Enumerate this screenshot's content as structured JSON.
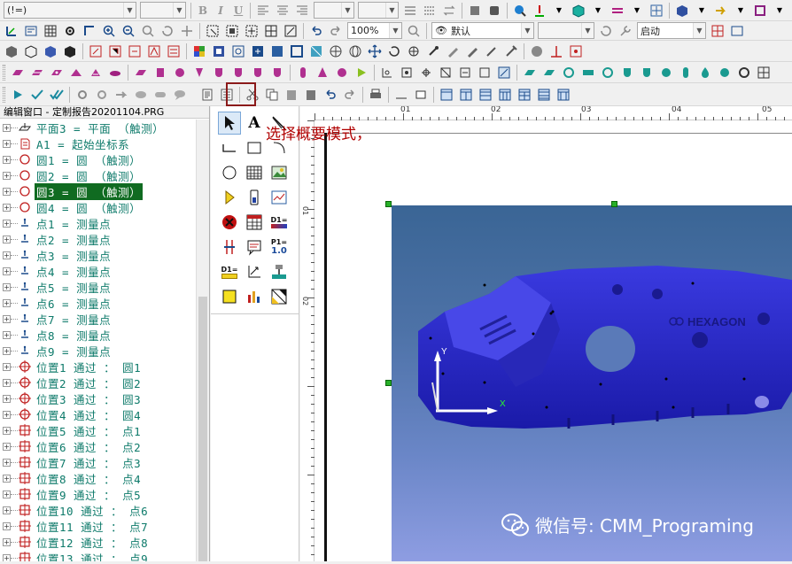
{
  "toolbar1": {
    "font_combo": "(!=)",
    "size_combo": "",
    "bold": "B",
    "italic": "I",
    "underline": "U"
  },
  "toolbar2": {
    "zoom": "100%",
    "view": "默认",
    "mode": "启动"
  },
  "edit_window": {
    "title": "编辑窗口 - 定制报告20201104.PRG",
    "items": [
      {
        "label": "平面3 = 平面 （触测）",
        "icon": "plane-icon",
        "selected": false
      },
      {
        "label": "A1 = 起始坐标系",
        "icon": "alignment-icon",
        "selected": false
      },
      {
        "label": "圆1 = 圆 （触测）",
        "icon": "circle-icon",
        "selected": false
      },
      {
        "label": "圆2 = 圆 （触测）",
        "icon": "circle-icon",
        "selected": false
      },
      {
        "label": "圆3 = 圆 （触测）",
        "icon": "circle-icon",
        "selected": true
      },
      {
        "label": "圆4 = 圆 （触测）",
        "icon": "circle-icon",
        "selected": false
      },
      {
        "label": "点1 = 测量点",
        "icon": "point-icon",
        "selected": false
      },
      {
        "label": "点2 = 测量点",
        "icon": "point-icon",
        "selected": false
      },
      {
        "label": "点3 = 测量点",
        "icon": "point-icon",
        "selected": false
      },
      {
        "label": "点4 = 测量点",
        "icon": "point-icon",
        "selected": false
      },
      {
        "label": "点5 = 测量点",
        "icon": "point-icon",
        "selected": false
      },
      {
        "label": "点6 = 测量点",
        "icon": "point-icon",
        "selected": false
      },
      {
        "label": "点7 = 测量点",
        "icon": "point-icon",
        "selected": false
      },
      {
        "label": "点8 = 测量点",
        "icon": "point-icon",
        "selected": false
      },
      {
        "label": "点9 = 测量点",
        "icon": "point-icon",
        "selected": false
      },
      {
        "label": "位置1 通过 ： 圆1",
        "icon": "position-circle-icon",
        "selected": false
      },
      {
        "label": "位置2 通过 ： 圆2",
        "icon": "position-circle-icon",
        "selected": false
      },
      {
        "label": "位置3 通过 ： 圆3",
        "icon": "position-circle-icon",
        "selected": false
      },
      {
        "label": "位置4 通过 ： 圆4",
        "icon": "position-circle-icon",
        "selected": false
      },
      {
        "label": "位置5 通过 ： 点1",
        "icon": "position-point-icon",
        "selected": false
      },
      {
        "label": "位置6 通过 ： 点2",
        "icon": "position-point-icon",
        "selected": false
      },
      {
        "label": "位置7 通过 ： 点3",
        "icon": "position-point-icon",
        "selected": false
      },
      {
        "label": "位置8 通过 ： 点4",
        "icon": "position-point-icon",
        "selected": false
      },
      {
        "label": "位置9 通过 ： 点5",
        "icon": "position-point-icon",
        "selected": false
      },
      {
        "label": "位置10 通过 ： 点6",
        "icon": "position-point-icon",
        "selected": false
      },
      {
        "label": "位置11 通过 ： 点7",
        "icon": "position-point-icon",
        "selected": false
      },
      {
        "label": "位置12 通过 ： 点8",
        "icon": "position-point-icon",
        "selected": false
      },
      {
        "label": "位置13 通过 ： 点9",
        "icon": "position-point-icon",
        "selected": false
      }
    ]
  },
  "toolbox": {
    "text_tool": "A",
    "label_p1": "P1=",
    "label_p1_value": "1.0",
    "label_d1": "D1="
  },
  "canvas": {
    "ruler_marks": [
      "01",
      "02",
      "03",
      "04",
      "05"
    ],
    "vruler_marks": [
      "01",
      "02"
    ],
    "callout": "选择概要模式，",
    "model_brand": "HEXAGON",
    "axis_x": "X",
    "axis_y": "Y",
    "watermark": "微信号: CMM_Programing"
  },
  "colors": {
    "tree_text": "#0d7a6a",
    "selected_bg": "#106b21",
    "callout": "#b00000",
    "part_blue": "#2a2ad0",
    "highlight_box": "#8b1a1a"
  }
}
